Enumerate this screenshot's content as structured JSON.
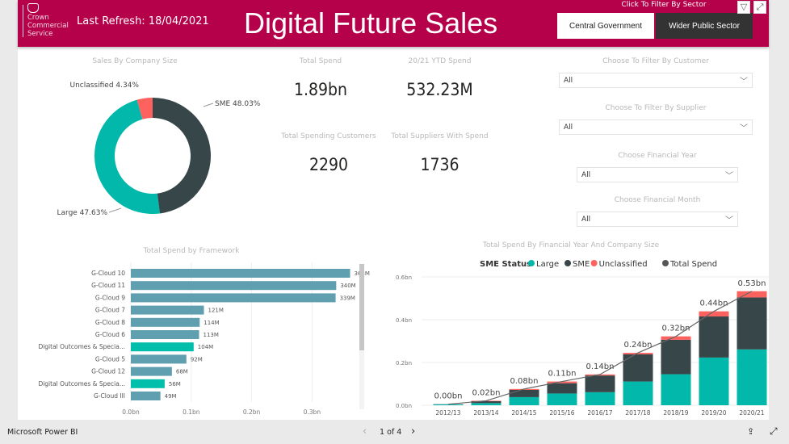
{
  "header": {
    "logo_text": "Crown Commercial Service",
    "last_refresh": "Last Refresh: 18/04/2021",
    "title": "Digital Future Sales",
    "sector_label": "Click To Filter By Sector",
    "sector_buttons": [
      "Central Government",
      "Wider Public Sector"
    ]
  },
  "kpis": [
    {
      "label": "Total Spend",
      "value": "1.89bn"
    },
    {
      "label": "20/21 YTD Spend",
      "value": "532.23M"
    },
    {
      "label": "Total Spending Customers",
      "value": "2290"
    },
    {
      "label": "Total Suppliers With Spend",
      "value": "1736"
    }
  ],
  "filters": [
    {
      "label": "Choose To Filter By Customer",
      "value": "All"
    },
    {
      "label": "Choose To Filter By Supplier",
      "value": "All"
    },
    {
      "label": "Choose Financial Year",
      "value": "All"
    },
    {
      "label": "Choose Financial Month",
      "value": "All"
    }
  ],
  "colors": {
    "brand": "#b5004a",
    "large": "#01b8aa",
    "sme": "#374649",
    "unclassified": "#fd625e",
    "framework_bar": "#5f9fb0",
    "framework_bar_highlight": "#01bfaa"
  },
  "chart_data": [
    {
      "type": "pie",
      "title": "Sales By Company Size",
      "slices": [
        {
          "name": "SME",
          "value": 48.03,
          "label": "SME 48.03%"
        },
        {
          "name": "Large",
          "value": 47.63,
          "label": "Large 47.63%"
        },
        {
          "name": "Unclassified",
          "value": 4.34,
          "label": "Unclassified 4.34%"
        }
      ]
    },
    {
      "type": "bar",
      "orientation": "horizontal",
      "title": "Total Spend by Framework",
      "categories": [
        "G-Cloud 10",
        "G-Cloud 11",
        "G-Cloud 9",
        "G-Cloud 7",
        "G-Cloud 8",
        "G-Cloud 6",
        "Digital Outcomes & Specia...",
        "G-Cloud 5",
        "G-Cloud 12",
        "Digital Outcomes & Specia...",
        "G-Cloud III"
      ],
      "values": [
        363,
        340,
        339,
        121,
        114,
        113,
        104,
        92,
        68,
        56,
        49
      ],
      "data_labels": [
        "363M",
        "340M",
        "339M",
        "121M",
        "114M",
        "113M",
        "104M",
        "92M",
        "68M",
        "56M",
        "49M"
      ],
      "unit": "M",
      "xticks": [
        "0.0bn",
        "0.1bn",
        "0.2bn",
        "0.3bn"
      ],
      "xlim": [
        0,
        0.4
      ],
      "grid": true
    },
    {
      "type": "bar",
      "stacked": true,
      "title": "Total Spend By Financial Year And Company Size",
      "legend_title": "SME Status",
      "legend": [
        "Large",
        "SME",
        "Unclassified",
        "Total Spend"
      ],
      "legend_placement": "top",
      "categories": [
        "2012/13",
        "2013/14",
        "2014/15",
        "2015/16",
        "2016/17",
        "2017/18",
        "2018/19",
        "2019/20",
        "2020/21"
      ],
      "series": [
        {
          "name": "Large",
          "values": [
            0.004,
            0.01,
            0.038,
            0.055,
            0.061,
            0.111,
            0.145,
            0.223,
            0.261
          ]
        },
        {
          "name": "SME",
          "values": [
            0.001,
            0.009,
            0.034,
            0.048,
            0.078,
            0.127,
            0.161,
            0.192,
            0.243
          ]
        },
        {
          "name": "Unclassified",
          "values": [
            0.0,
            0.002,
            0.004,
            0.008,
            0.005,
            0.007,
            0.016,
            0.024,
            0.029
          ]
        }
      ],
      "line": {
        "name": "Total Spend",
        "values": [
          0.005,
          0.021,
          0.076,
          0.111,
          0.144,
          0.245,
          0.322,
          0.439,
          0.533
        ],
        "labels": [
          "0.00bn",
          "0.02bn",
          "0.08bn",
          "0.11bn",
          "0.14bn",
          "0.24bn",
          "0.32bn",
          "0.44bn",
          "0.53bn"
        ]
      },
      "yticks": [
        "0.0bn",
        "0.2bn",
        "0.4bn",
        "0.6bn"
      ],
      "ylim": [
        0,
        0.6
      ],
      "grid": true
    }
  ],
  "footer": {
    "app": "Microsoft Power BI",
    "page": "1 of 4"
  }
}
